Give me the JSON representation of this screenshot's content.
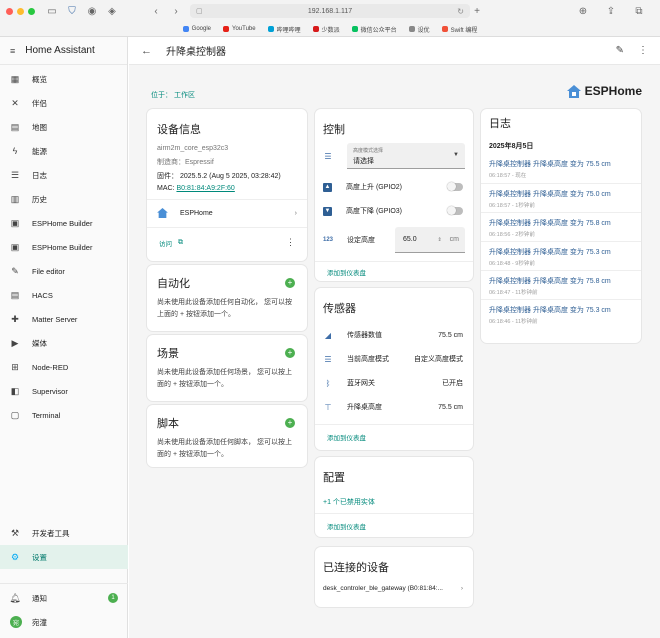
{
  "browser": {
    "url": "192.168.1.117",
    "bookmarks": [
      "Google",
      "YouTube",
      "哔哩哔哩",
      "少数派",
      "微信公众平台",
      "设优",
      "Swift 编程"
    ]
  },
  "sidebar": {
    "title": "Home Assistant",
    "items": [
      {
        "label": "概览",
        "icon": "grid-icon"
      },
      {
        "label": "伴侣",
        "icon": "tools-icon"
      },
      {
        "label": "地图",
        "icon": "map-icon"
      },
      {
        "label": "能源",
        "icon": "lightning-icon"
      },
      {
        "label": "日志",
        "icon": "list-icon"
      },
      {
        "label": "历史",
        "icon": "chart-icon"
      },
      {
        "label": "ESPHome Builder",
        "icon": "dashboard-icon"
      },
      {
        "label": "ESPHome Builder",
        "icon": "dashboard-icon"
      },
      {
        "label": "File editor",
        "icon": "wrench-icon"
      },
      {
        "label": "HACS",
        "icon": "hacs-icon"
      },
      {
        "label": "Matter Server",
        "icon": "puzzle-icon"
      },
      {
        "label": "媒体",
        "icon": "media-icon"
      },
      {
        "label": "Node-RED",
        "icon": "sitemap-icon"
      },
      {
        "label": "Supervisor",
        "icon": "supervisor-icon"
      },
      {
        "label": "Terminal",
        "icon": "terminal-icon"
      }
    ],
    "dev_tools": "开发者工具",
    "settings": "设置",
    "notifications": "通知",
    "notification_count": "1",
    "user": "宛潼",
    "user_initial": "宛"
  },
  "topbar": {
    "title": "升降桌控制器"
  },
  "breadcrumb": "位于： 工作区",
  "brand": "ESPHome",
  "device_info": {
    "title": "设备信息",
    "model": "airm2m_core_esp32c3",
    "maker": "制造商：Espressif",
    "firmware": "固件：  2025.5.2 (Aug 5 2025, 03:28:42)",
    "mac_label": "MAC: ",
    "mac": "B0:81:84:A9:2F:60",
    "integration": "ESPHome",
    "visit": "访问"
  },
  "automation": {
    "title": "自动化",
    "desc": "尚未使用此设备添加任何自动化， 您可以按上面的 + 按钮添加一个。"
  },
  "scene": {
    "title": "场景",
    "desc": "尚未使用此设备添加任何场景， 您可以按上面的 + 按钮添加一个。"
  },
  "script": {
    "title": "脚本",
    "desc": "尚未使用此设备添加任何脚本， 您可以按上面的 + 按钮添加一个。"
  },
  "control": {
    "title": "控制",
    "select_label": "高度模式选择",
    "select_value": "请选择",
    "up_label": "高度上升 (GPIO2)",
    "down_label": "高度下降 (GPIO3)",
    "height_label": "设定高度",
    "height_value": "65.0",
    "height_unit": "cm",
    "add": "添加到仪表盘"
  },
  "sensors": {
    "title": "传感器",
    "rows": [
      {
        "label": "传感器数值",
        "value": "75.5 cm"
      },
      {
        "label": "当前高度模式",
        "value": "自定义高度模式"
      },
      {
        "label": "蓝牙网关",
        "value": "已开启"
      },
      {
        "label": "升降桌高度",
        "value": "75.5 cm"
      }
    ],
    "add": "添加到仪表盘"
  },
  "config": {
    "title": "配置",
    "disabled": "+1 个已禁用实体",
    "add": "添加到仪表盘"
  },
  "connected": {
    "title": "已连接的设备",
    "device": "desk_controler_ble_gateway (B0:81:84:..."
  },
  "logbook": {
    "title": "日志",
    "date": "2025年8月5日",
    "entries": [
      {
        "entity": "升降桌控制器",
        "text": "升降桌高度 变为 75.5 cm",
        "time": "06:18:57 - 现在"
      },
      {
        "entity": "升降桌控制器",
        "text": "升降桌高度 变为 75.0 cm",
        "time": "06:18:57 - 1秒钟前"
      },
      {
        "entity": "升降桌控制器",
        "text": "升降桌高度 变为 75.8 cm",
        "time": "06:18:56 - 2秒钟前"
      },
      {
        "entity": "升降桌控制器",
        "text": "升降桌高度 变为 75.3 cm",
        "time": "06:18:48 - 9秒钟前"
      },
      {
        "entity": "升降桌控制器",
        "text": "升降桌高度 变为 75.8 cm",
        "time": "06:18:47 - 11秒钟前"
      },
      {
        "entity": "升降桌控制器",
        "text": "升降桌高度 变为 75.3 cm",
        "time": "06:18:46 - 11秒钟前"
      }
    ]
  }
}
